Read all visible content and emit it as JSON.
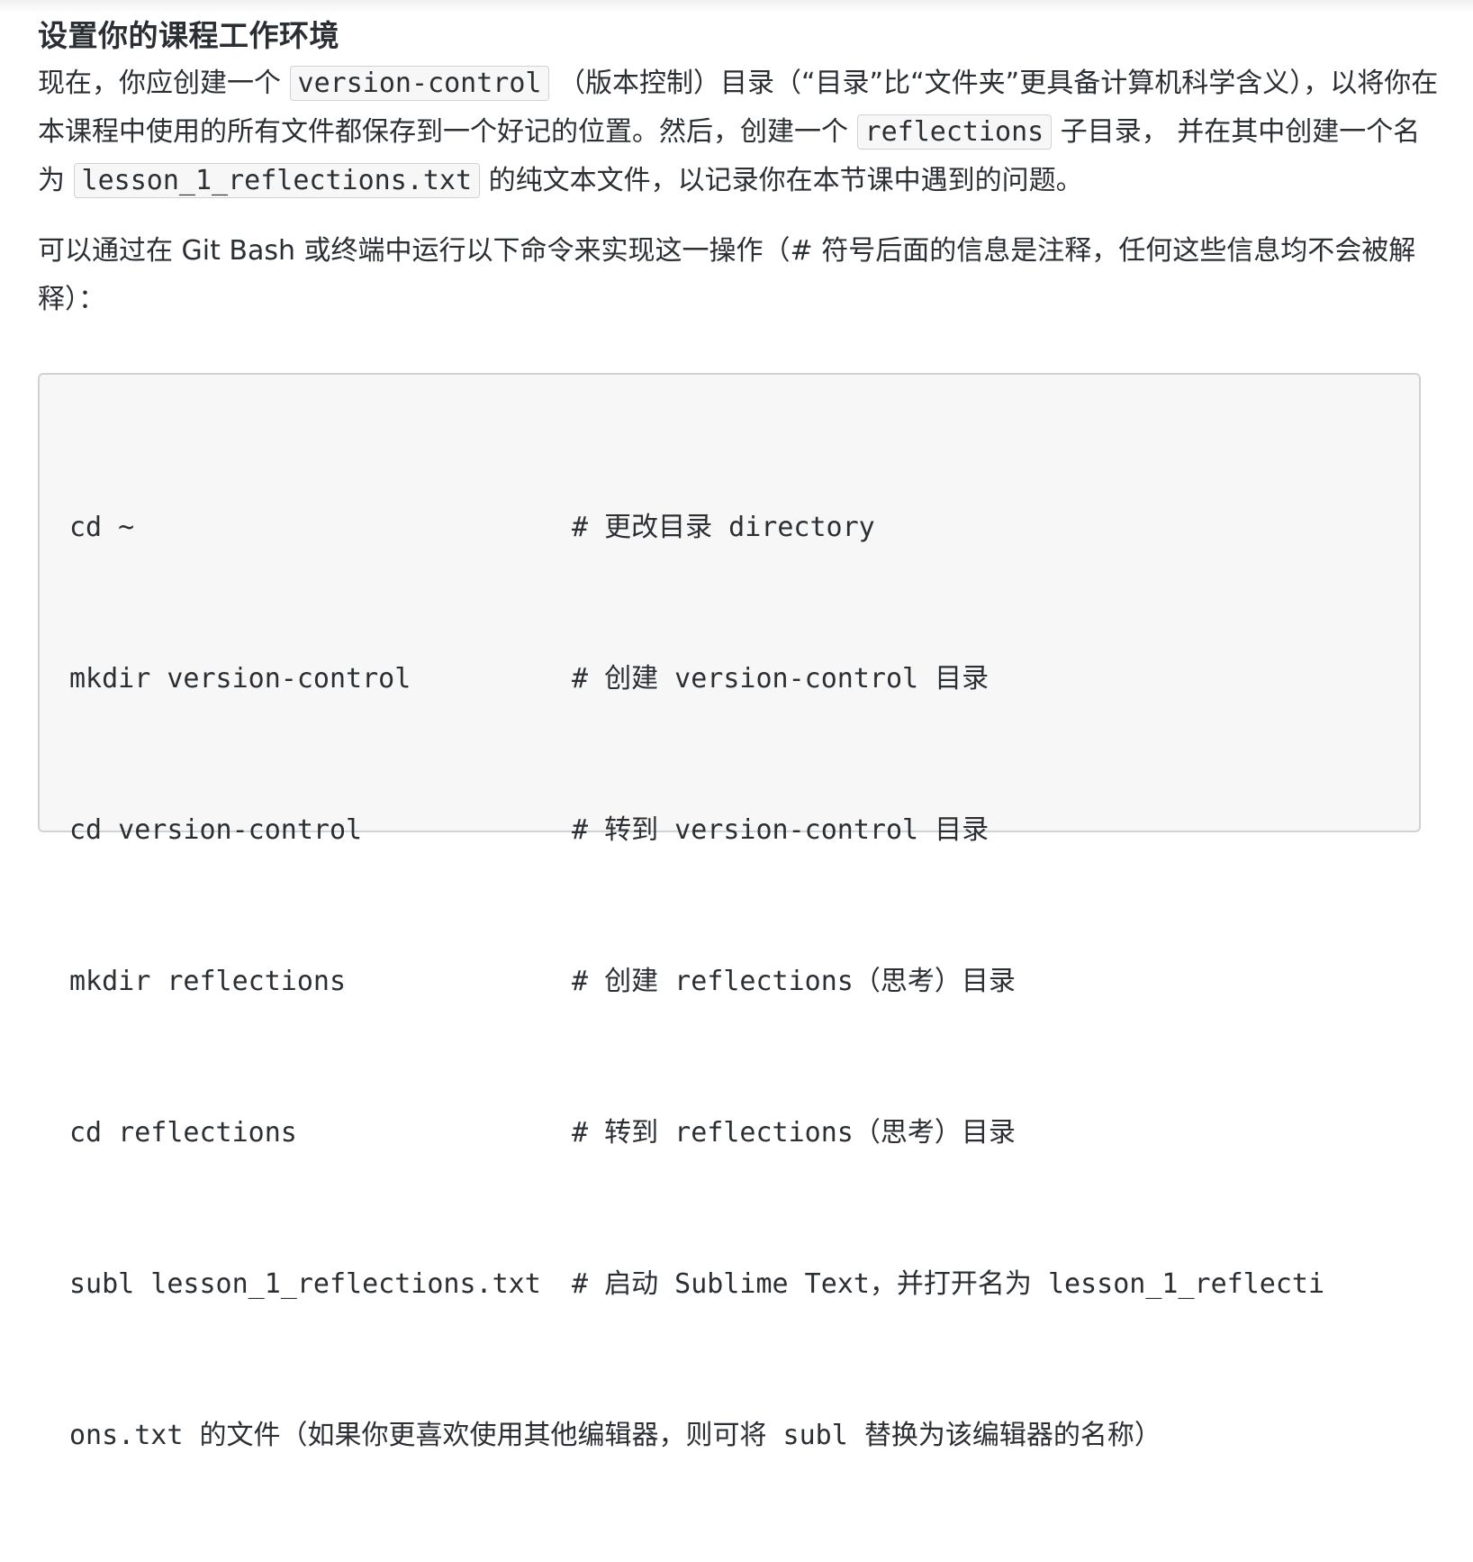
{
  "section": {
    "title": "设置你的课程工作环境"
  },
  "para1": {
    "t1": "现在，你应创建一个 ",
    "code1": "version-control",
    "t2": " （版本控制）目录（“目录”比“文件夹”更具备计算机科学含义），以将你在本课程中使用的所有文件都保存到一个好记的位置。然后，创建一个 ",
    "code2": "reflections",
    "t3": " 子目录， 并在其中创建一个名为 ",
    "code3": "lesson_1_reflections.txt",
    "t4": " 的纯文本文件，以记录你在本节课中遇到的问题。"
  },
  "para2": {
    "text": "可以通过在 Git Bash 或终端中运行以下命令来实现这一操作（# 符号后面的信息是注释，任何这些信息均不会被解释）："
  },
  "code_block": {
    "lines": [
      {
        "cmd": "cd ~",
        "comment": "# 更改目录 directory"
      },
      {
        "cmd": "mkdir version-control",
        "comment": "# 创建 version-control 目录"
      },
      {
        "cmd": "cd version-control",
        "comment": "# 转到 version-control 目录"
      },
      {
        "cmd": "mkdir reflections",
        "comment": "# 创建 reflections（思考）目录"
      },
      {
        "cmd": "cd reflections",
        "comment": "# 转到 reflections（思考）目录"
      },
      {
        "cmd": "subl lesson_1_reflections.txt",
        "comment": "# 启动 Sublime Text，并打开名为 lesson_1_reflecti"
      },
      {
        "cmd": "ons.txt 的文件（如果你更喜欢使用其他编辑器，则可将 subl 替换为该编辑器的名称）",
        "comment": ""
      }
    ]
  }
}
